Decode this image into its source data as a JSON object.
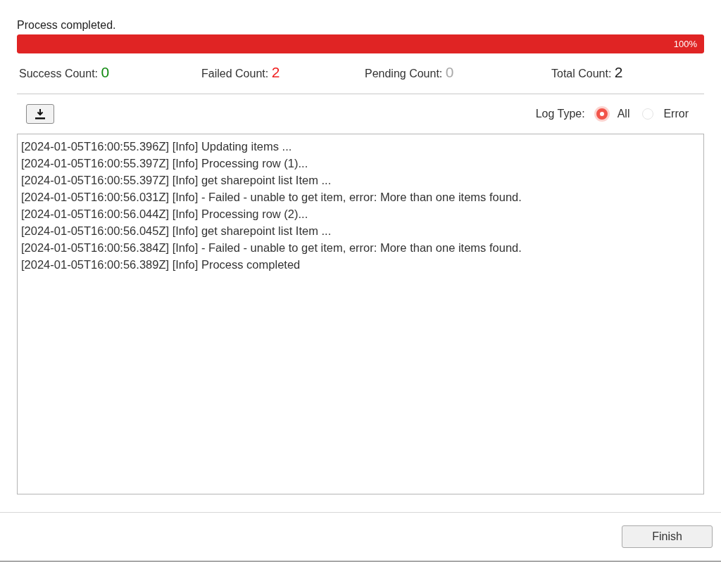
{
  "status_text": "Process completed.",
  "progress": {
    "level": 1,
    "label": "100%"
  },
  "counts": [
    {
      "label": "Success Count:",
      "value": "0",
      "kind": "success"
    },
    {
      "label": "Failed Count:",
      "value": "2",
      "kind": "failed"
    },
    {
      "label": "Pending Count:",
      "value": "0",
      "kind": "pending"
    },
    {
      "label": "Total Count:",
      "value": "2",
      "kind": "total"
    }
  ],
  "log_type": {
    "label": "Log Type:",
    "options": [
      {
        "label": "All",
        "selected": true
      },
      {
        "label": "Error",
        "selected": false
      }
    ]
  },
  "log_lines": [
    "[2024-01-05T16:00:55.396Z] [Info] Updating items ...",
    "[2024-01-05T16:00:55.397Z] [Info] Processing row (1)...",
    "[2024-01-05T16:00:55.397Z] [Info] get sharepoint list Item ...",
    "[2024-01-05T16:00:56.031Z] [Info] - Failed - unable to get item, error: More than one items found.",
    "[2024-01-05T16:00:56.044Z] [Info] Processing row (2)...",
    "[2024-01-05T16:00:56.045Z] [Info] get sharepoint list Item ...",
    "[2024-01-05T16:00:56.384Z] [Info] - Failed - unable to get item, error: More than one items found.",
    "[2024-01-05T16:00:56.389Z] [Info] Process completed"
  ],
  "buttons": [
    {
      "label": "Finish"
    }
  ]
}
